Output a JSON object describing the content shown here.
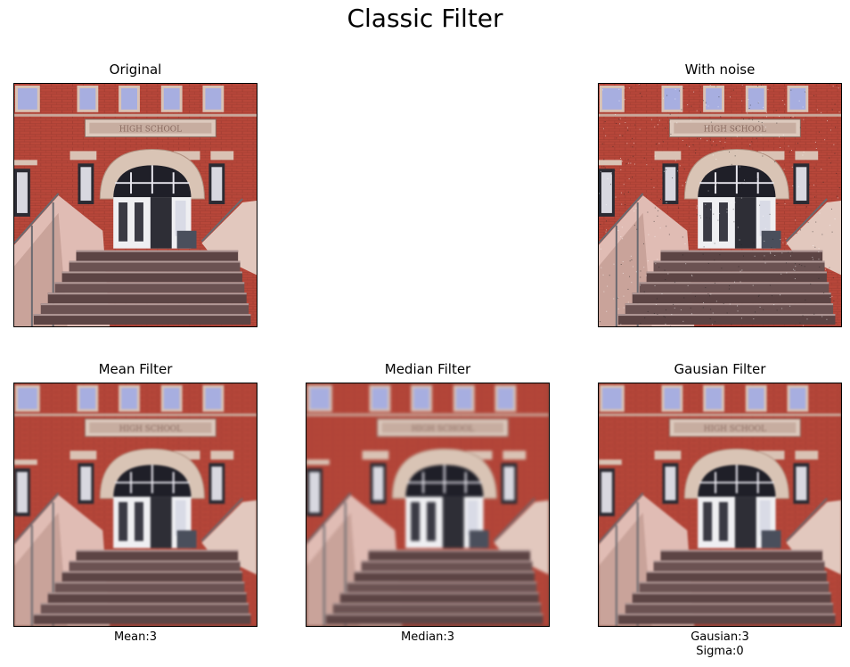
{
  "figure": {
    "title": "Classic Filter"
  },
  "panels": [
    {
      "id": "original",
      "title": "Original",
      "xlabel": "",
      "xlabel2": ""
    },
    {
      "id": "noise",
      "title": "With noise",
      "xlabel": "",
      "xlabel2": ""
    },
    {
      "id": "mean",
      "title": "Mean Filter",
      "xlabel": "Mean:3",
      "xlabel2": ""
    },
    {
      "id": "median",
      "title": "Median Filter",
      "xlabel": "Median:3",
      "xlabel2": ""
    },
    {
      "id": "gaussian",
      "title": "Gausian Filter",
      "xlabel": "Gausian:3",
      "xlabel2": "Sigma:0"
    }
  ],
  "sign_text": "HIGH SCHOOL",
  "colors": {
    "brick": "#b8473a",
    "stone": "#d9c2b4",
    "window": "#a7aee0",
    "steps": "#5c4444"
  }
}
